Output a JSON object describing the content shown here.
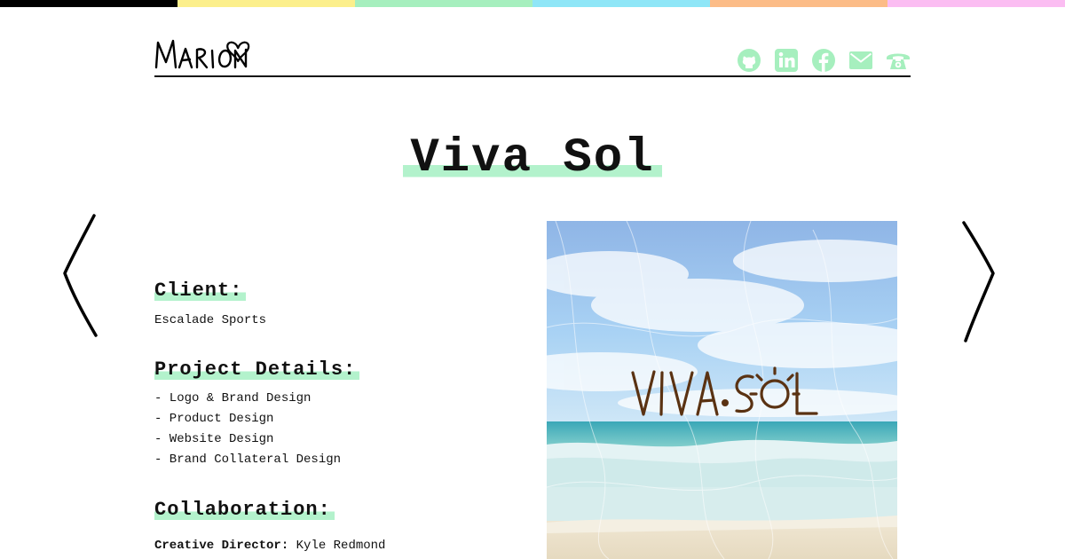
{
  "top_stripe": {
    "colors": [
      "#000000",
      "#fcef8c",
      "#a6efbe",
      "#8fe6f7",
      "#fcbc87",
      "#fbbdf2"
    ]
  },
  "header": {
    "logo_text": "Marion♡",
    "social_icons": [
      {
        "icon": "github-icon"
      },
      {
        "icon": "linkedin-icon"
      },
      {
        "icon": "facebook-icon"
      },
      {
        "icon": "mail-icon"
      },
      {
        "icon": "phone-icon"
      }
    ],
    "icon_color": "#a6efbe"
  },
  "project": {
    "title": "Viva Sol",
    "highlight_color": "#b3f2cc",
    "client_heading": "Client:",
    "client_name": "Escalade Sports",
    "details_heading": "Project Details:",
    "details": [
      "- Logo & Brand Design",
      "- Product Design",
      "- Website Design",
      "- Brand Collateral Design"
    ],
    "collaboration_heading": "Collaboration:",
    "credits": [
      {
        "role": "Creative Director:",
        "name": "Kyle Redmond"
      }
    ]
  },
  "image": {
    "logo_text": "VIVA·SOL",
    "logo_color": "#5a3212"
  },
  "navigation": {
    "prev": "previous-arrow-icon",
    "next": "next-arrow-icon"
  }
}
